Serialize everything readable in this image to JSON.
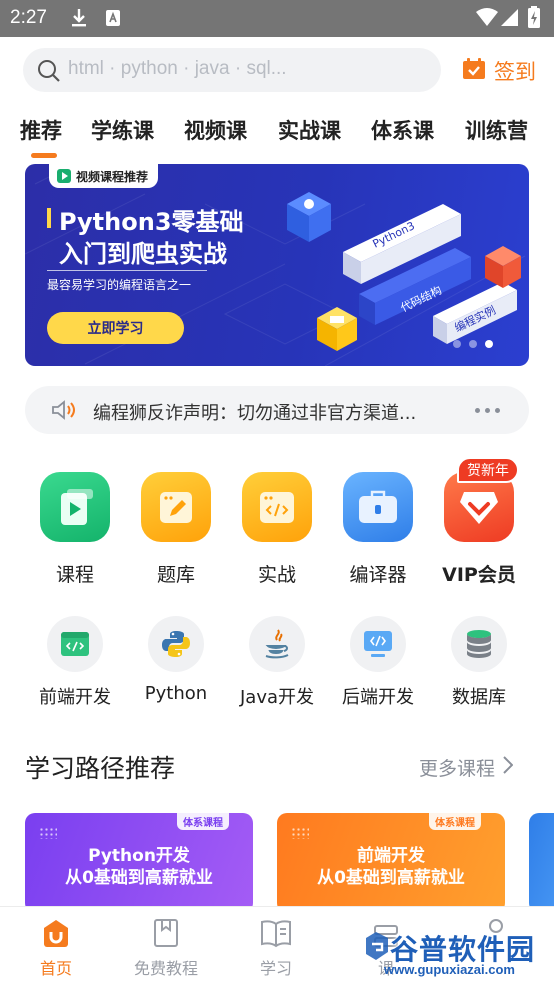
{
  "status_bar": {
    "time": "2:27"
  },
  "search": {
    "placeholder": "html · python · java · sql..."
  },
  "signin": {
    "label": "签到"
  },
  "tabs": [
    "推荐",
    "学练课",
    "视频课",
    "实战课",
    "体系课",
    "训练营"
  ],
  "banner": {
    "tag": "视频课程推荐",
    "title_line1": "Python3零基础",
    "title_line2": "入门到爬虫实战",
    "subtitle": "最容易学习的编程语言之一",
    "cta": "立即学习",
    "block_labels": [
      "Python3",
      "代码结构",
      "编程实例"
    ],
    "slide_count": 3,
    "active_slide": 3
  },
  "notice": {
    "text": "编程狮反诈声明：切勿通过非官方渠道..."
  },
  "main_icons": [
    {
      "label": "课程",
      "icon": "course-icon",
      "color": "#22c07a"
    },
    {
      "label": "题库",
      "icon": "question-bank-icon",
      "color": "#ffb21a"
    },
    {
      "label": "实战",
      "icon": "practice-code-icon",
      "color": "#ffb21a"
    },
    {
      "label": "编译器",
      "icon": "compiler-toolbox-icon",
      "color": "#3d8ff0"
    },
    {
      "label": "VIP会员",
      "icon": "vip-heart-icon",
      "color": "#f2572f",
      "badge": "贺新年"
    }
  ],
  "sub_icons": [
    {
      "label": "前端开发",
      "icon": "frontend-icon"
    },
    {
      "label": "Python",
      "icon": "python-icon"
    },
    {
      "label": "Java开发",
      "icon": "java-icon"
    },
    {
      "label": "后端开发",
      "icon": "backend-icon"
    },
    {
      "label": "数据库",
      "icon": "database-icon"
    }
  ],
  "section": {
    "title": "学习路径推荐",
    "more": "更多课程"
  },
  "path_cards": [
    {
      "tag": "体系课程",
      "line1": "Python开发",
      "line2": "从0基础到高薪就业",
      "color_from": "#7a3ff0",
      "color_to": "#a45cf5"
    },
    {
      "tag": "体系课程",
      "line1": "前端开发",
      "line2": "从0基础到高薪就业",
      "color_from": "#ff7a1f",
      "color_to": "#ffa02e"
    }
  ],
  "bottom_nav": [
    {
      "label": "首页",
      "icon": "home-icon",
      "active": true
    },
    {
      "label": "免费教程",
      "icon": "bookmark-book-icon",
      "active": false
    },
    {
      "label": "学习",
      "icon": "open-book-icon",
      "active": false
    },
    {
      "label": "课",
      "icon": "course-list-icon",
      "active": false
    },
    {
      "label": "",
      "icon": "profile-icon",
      "active": false
    }
  ],
  "watermark": {
    "name": "谷普软件园",
    "url": "www.gupuxiazai.com"
  },
  "colors": {
    "accent": "#f57b1e",
    "banner_bg": "#2734b8"
  }
}
